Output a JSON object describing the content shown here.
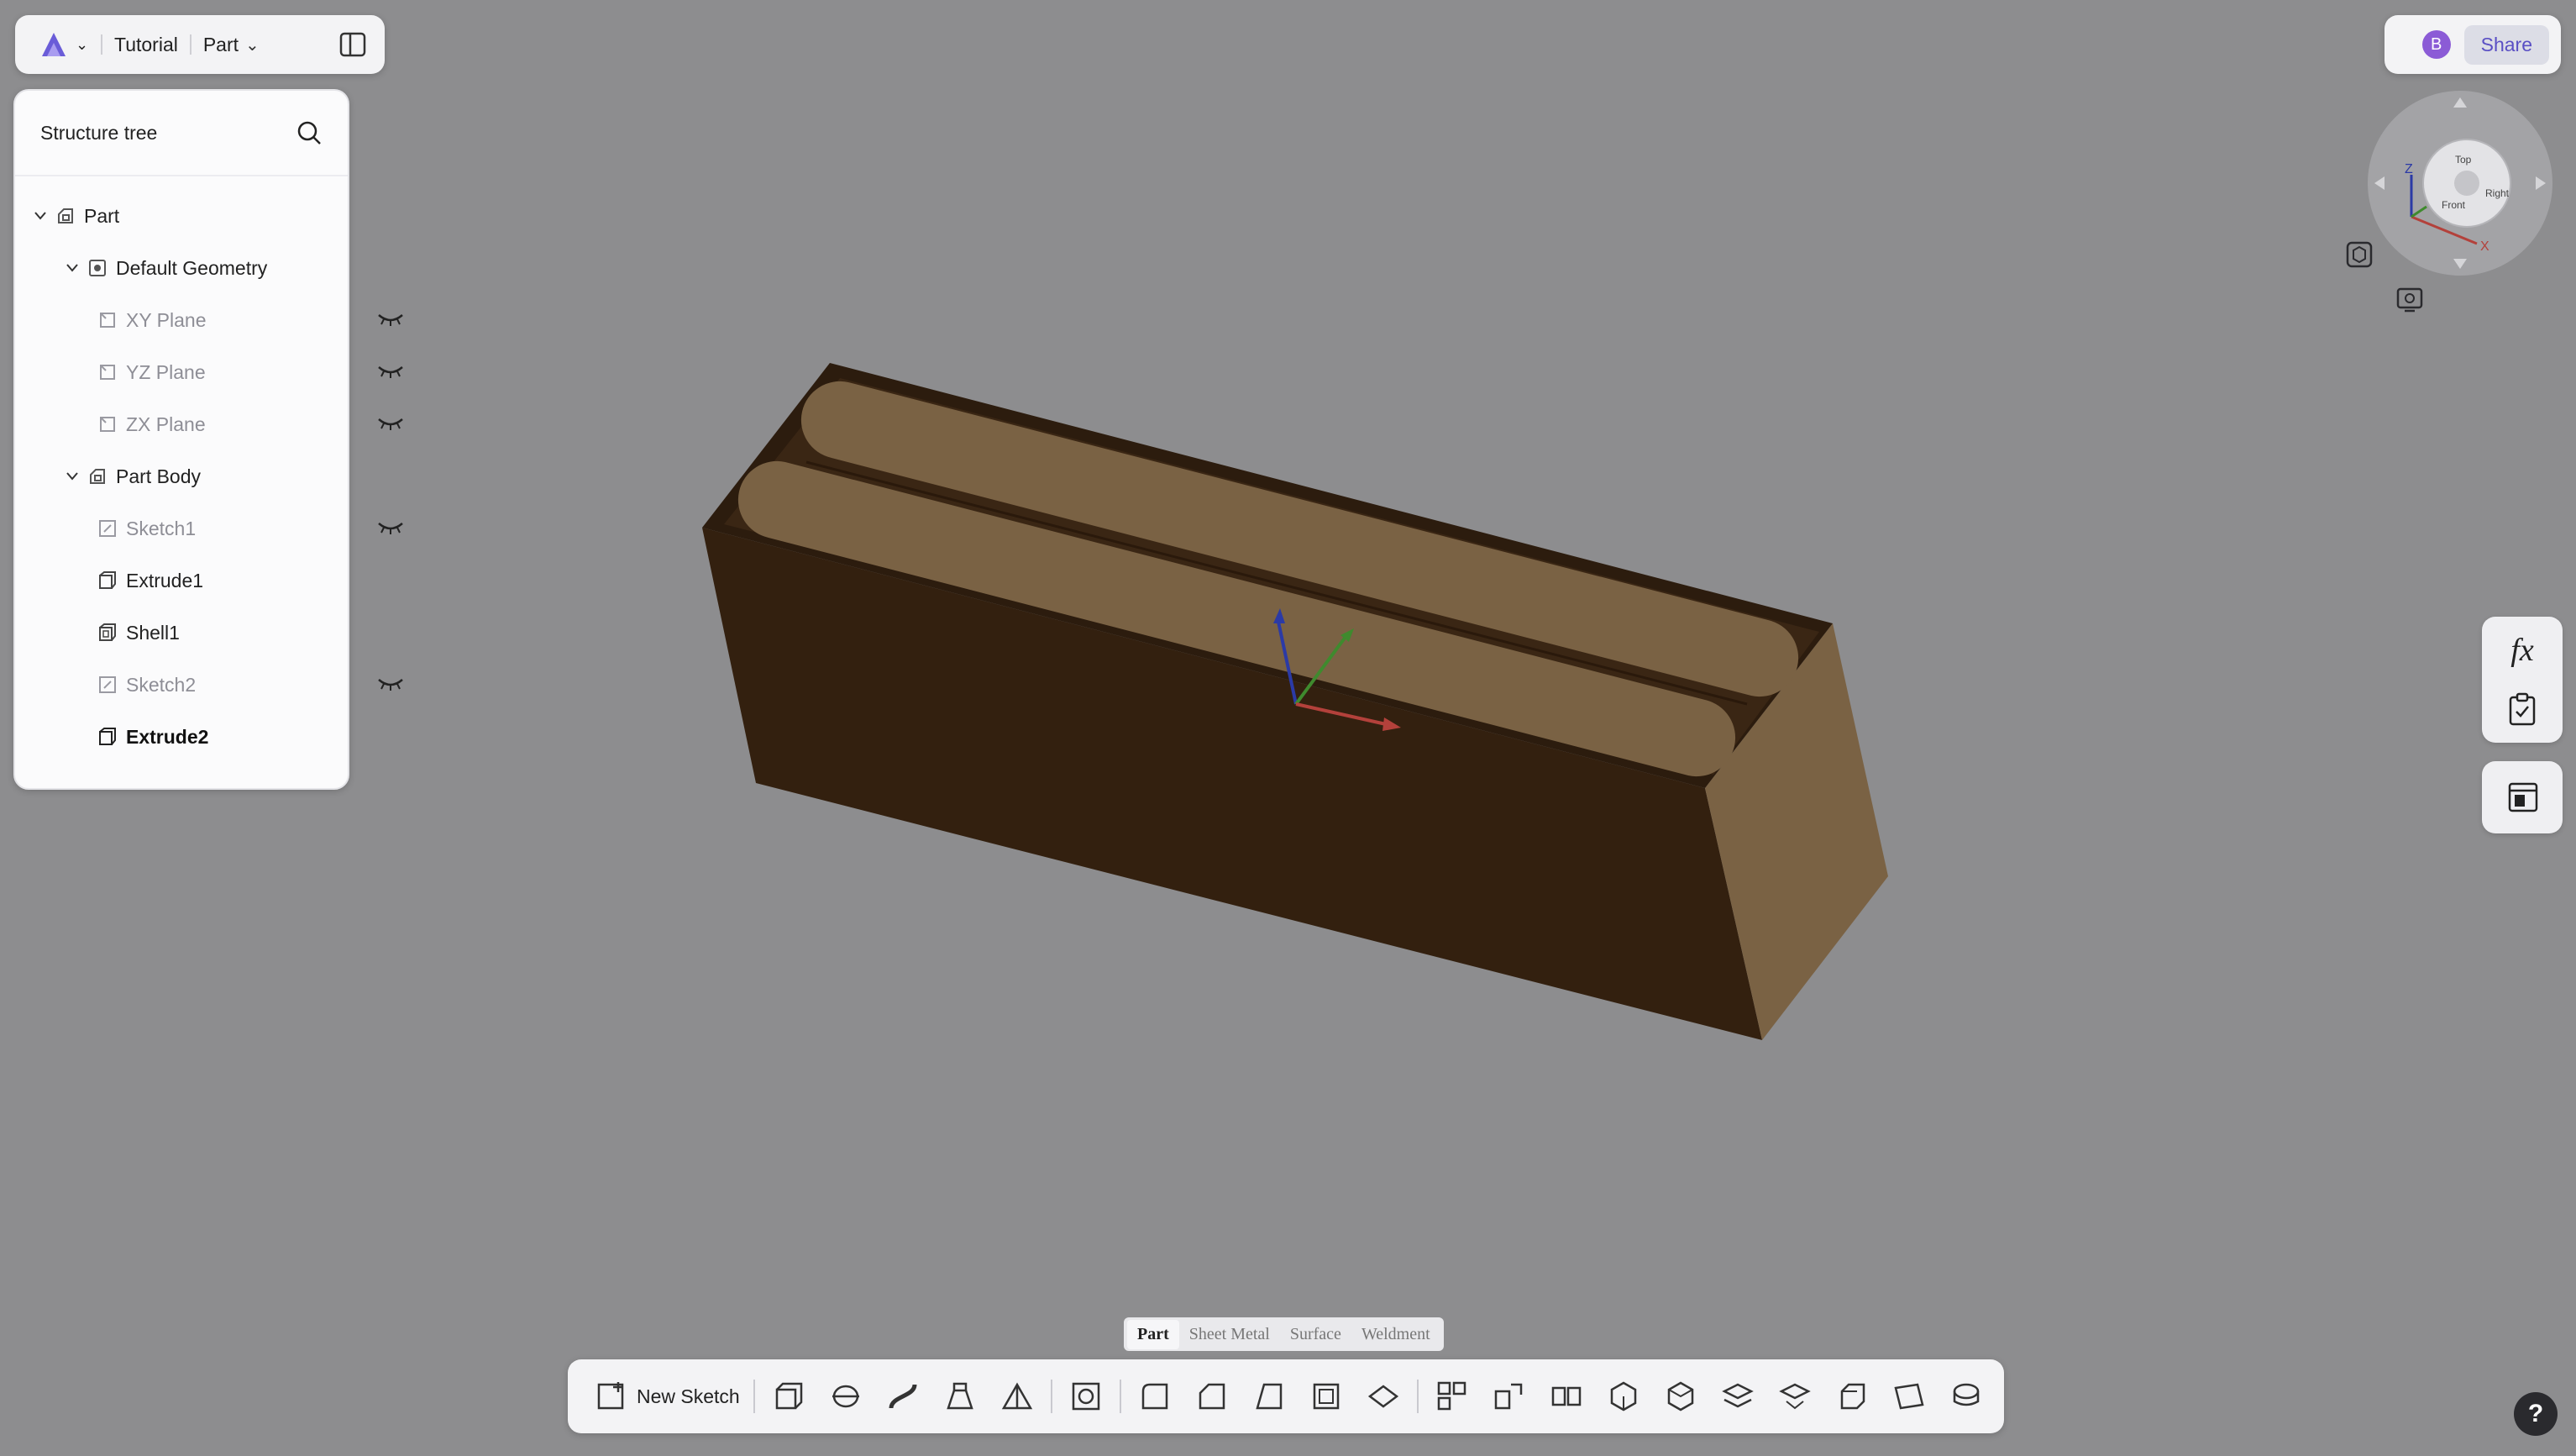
{
  "topbar": {
    "doc_name": "Tutorial",
    "mode": "Part"
  },
  "tree": {
    "title": "Structure tree",
    "items": [
      {
        "label": "Part"
      },
      {
        "label": "Default Geometry"
      },
      {
        "label": "XY Plane"
      },
      {
        "label": "YZ Plane"
      },
      {
        "label": "ZX Plane"
      },
      {
        "label": "Part Body"
      },
      {
        "label": "Sketch1"
      },
      {
        "label": "Extrude1"
      },
      {
        "label": "Shell1"
      },
      {
        "label": "Sketch2"
      },
      {
        "label": "Extrude2"
      }
    ]
  },
  "topright": {
    "user_badge": "B",
    "share_label": "Share"
  },
  "viewcube": {
    "faces": [
      "Top",
      "Front",
      "Right"
    ],
    "axes": [
      "X",
      "Z"
    ]
  },
  "sidetools": {
    "formula_label": "fx"
  },
  "tabs": [
    "Part",
    "Sheet Metal",
    "Surface",
    "Weldment"
  ],
  "toolbar": {
    "new_sketch_label": "New Sketch"
  },
  "help_label": "?",
  "colors": {
    "background": "#8d8d8f",
    "model_dark": "#33200f",
    "model_light": "#7a6244",
    "accent": "#5a4fc4"
  }
}
